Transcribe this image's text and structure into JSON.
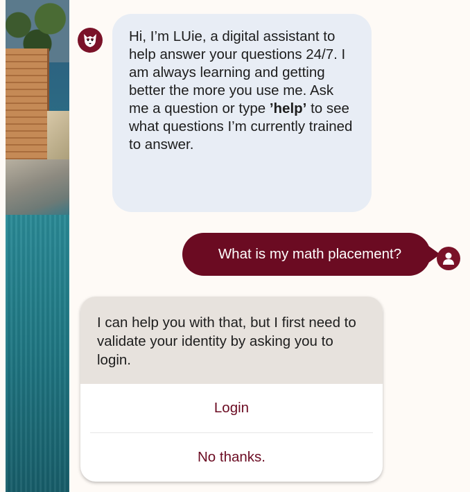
{
  "conversation": {
    "bot_intro": {
      "part1": "Hi, I’m LUie, a digital assistant to help answer your questions 24/7. I am always learning and getting better the more you use me. Ask me a question or type ",
      "keyword": "’help’",
      "part2": " to see what questions I’m currently trained to answer."
    },
    "user_message": "What is my math placement?",
    "bot_reply": "I can help you with that, but I first need to validate your identity by asking you to login.",
    "options": [
      "Login",
      "No thanks."
    ]
  },
  "icons": {
    "bot_avatar": "wolf-mascot-icon",
    "user_avatar": "user-person-icon"
  },
  "colors": {
    "brand": "#6b0b22",
    "bot_bubble": "#e8edf5",
    "card_header": "#e7e2dd",
    "background": "#fefaf6"
  }
}
